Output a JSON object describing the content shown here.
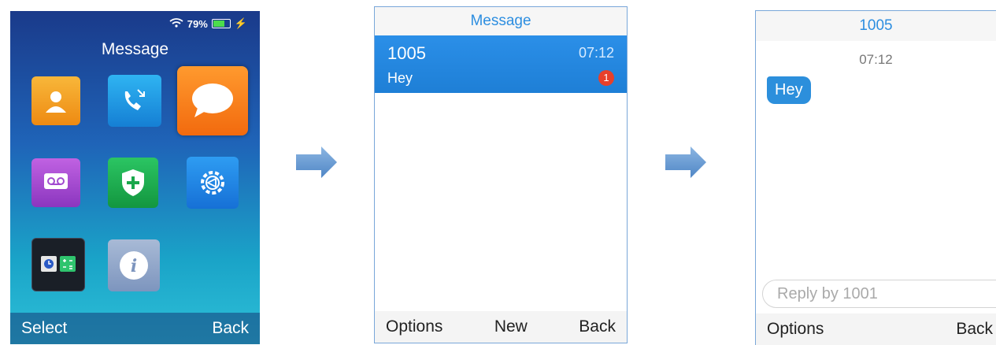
{
  "screen1": {
    "status": {
      "signal_icon": "wifi-signal-icon",
      "battery_percent": "79%",
      "battery_level": 0.79,
      "charging_icon": "charging-bolt-icon"
    },
    "title": "Message",
    "apps": [
      {
        "icon": "contacts-icon",
        "color": "#f5a623"
      },
      {
        "icon": "call-history-icon",
        "color": "#1fa0e6"
      },
      {
        "icon": "message-icon",
        "color": "#f57a1a",
        "selected": true
      },
      {
        "icon": "voicemail-icon",
        "color": "#a94fd0"
      },
      {
        "icon": "emergency-shield-icon",
        "color": "#1cae4f"
      },
      {
        "icon": "settings-gear-icon",
        "color": "#1c86e8"
      },
      {
        "icon": "clock-calculator-icon",
        "color": "#1e2a38"
      },
      {
        "icon": "info-icon",
        "color": "#8ea6c9"
      }
    ],
    "softkeys": {
      "left": "Select",
      "right": "Back"
    }
  },
  "screen2": {
    "title": "Message",
    "thread": {
      "name": "1005",
      "time": "07:12",
      "preview": "Hey",
      "unread": "1"
    },
    "softkeys": {
      "left": "Options",
      "center": "New",
      "right": "Back"
    }
  },
  "screen3": {
    "title": "1005",
    "timestamp": "07:12",
    "message": "Hey",
    "reply_placeholder": "Reply by 1001",
    "softkeys": {
      "left": "Options",
      "right": "Back"
    }
  }
}
